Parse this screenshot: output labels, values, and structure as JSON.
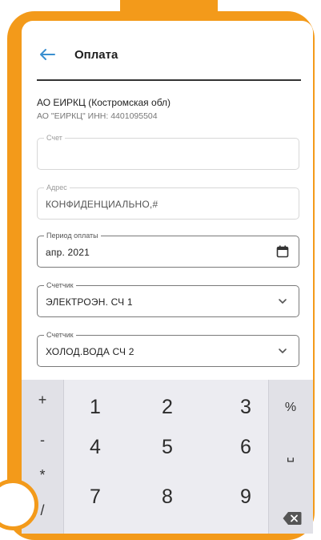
{
  "header": {
    "title": "Оплата"
  },
  "provider": {
    "name": "АО ЕИРКЦ (Костромская обл)",
    "details": "АО \"ЕИРКЦ\" ИНН: 4401095504"
  },
  "fields": {
    "account": {
      "label": "Счет",
      "value": ""
    },
    "address": {
      "label": "Адрес",
      "value": "КОНФИДЕНЦИАЛЬНО,#"
    },
    "period": {
      "label": "Период оплаты",
      "value": "апр. 2021"
    },
    "meter1": {
      "label": "Счетчик",
      "value": "ЭЛЕКТРОЭН. СЧ 1"
    },
    "meter2": {
      "label": "Счетчик",
      "value": "ХОЛОД.ВОДА СЧ 2"
    }
  },
  "keyboard": {
    "left_keys": [
      "+",
      "-",
      "*",
      "/"
    ],
    "digits": [
      "1",
      "2",
      "3",
      "4",
      "5",
      "6",
      "7",
      "8",
      "9"
    ],
    "right_keys": {
      "percent": "%",
      "space": "␣"
    }
  },
  "colors": {
    "accent": "#f39a1a",
    "back_arrow": "#3a8fd0"
  }
}
